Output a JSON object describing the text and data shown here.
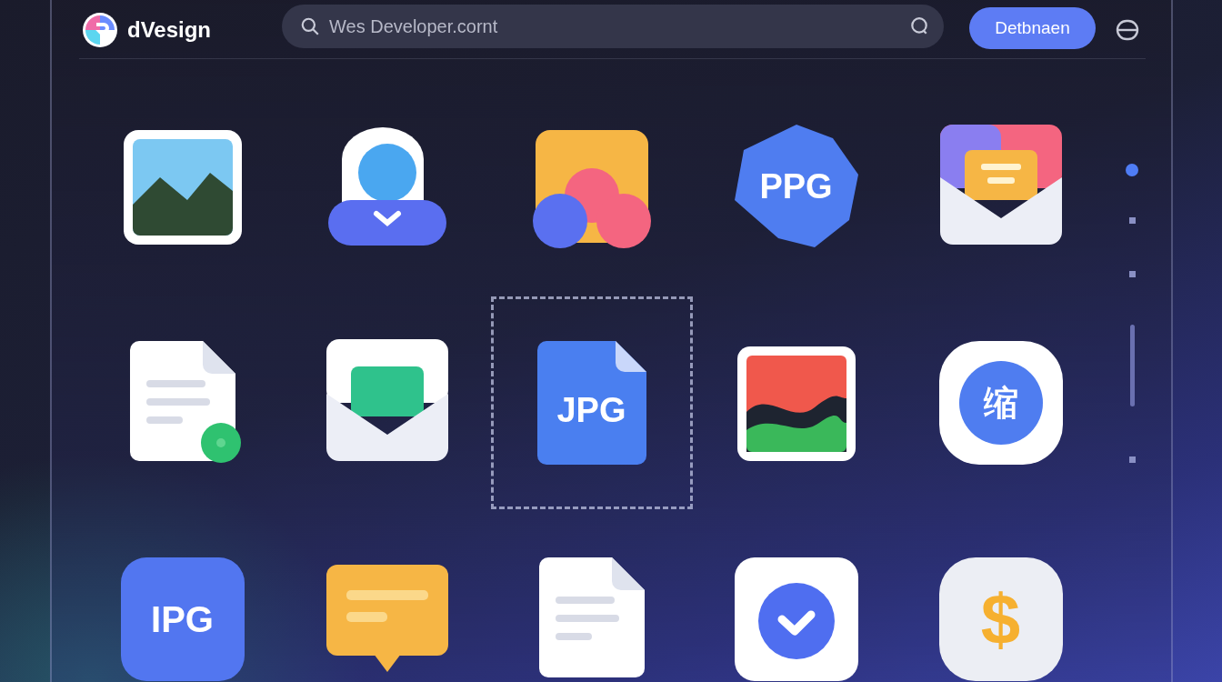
{
  "header": {
    "logo_text": "dVesign",
    "search": {
      "value": "Wes Developer.cornt"
    },
    "button": "Detbnaen"
  },
  "tiles": [
    {
      "kind": "picture",
      "selected": false
    },
    {
      "kind": "cloud",
      "selected": false
    },
    {
      "kind": "photos",
      "selected": false
    },
    {
      "kind": "badge",
      "label": "PPG",
      "selected": false
    },
    {
      "kind": "mail",
      "selected": false
    },
    {
      "kind": "document-dot",
      "selected": false
    },
    {
      "kind": "mail-green",
      "selected": false
    },
    {
      "kind": "file",
      "label": "JPG",
      "selected": true
    },
    {
      "kind": "wave",
      "selected": false
    },
    {
      "kind": "circle",
      "label": "缩",
      "selected": false
    },
    {
      "kind": "tile",
      "label": "IPG",
      "selected": false
    },
    {
      "kind": "chat",
      "selected": false
    },
    {
      "kind": "document",
      "selected": false
    },
    {
      "kind": "check",
      "selected": false
    },
    {
      "kind": "coin",
      "label": "$",
      "selected": false
    }
  ],
  "nav": [
    {
      "kind": "dot",
      "selected": true
    },
    {
      "kind": "dot",
      "selected": false
    },
    {
      "kind": "dot",
      "selected": false
    },
    {
      "kind": "bar",
      "selected": false
    },
    {
      "kind": "dot",
      "selected": false
    }
  ]
}
